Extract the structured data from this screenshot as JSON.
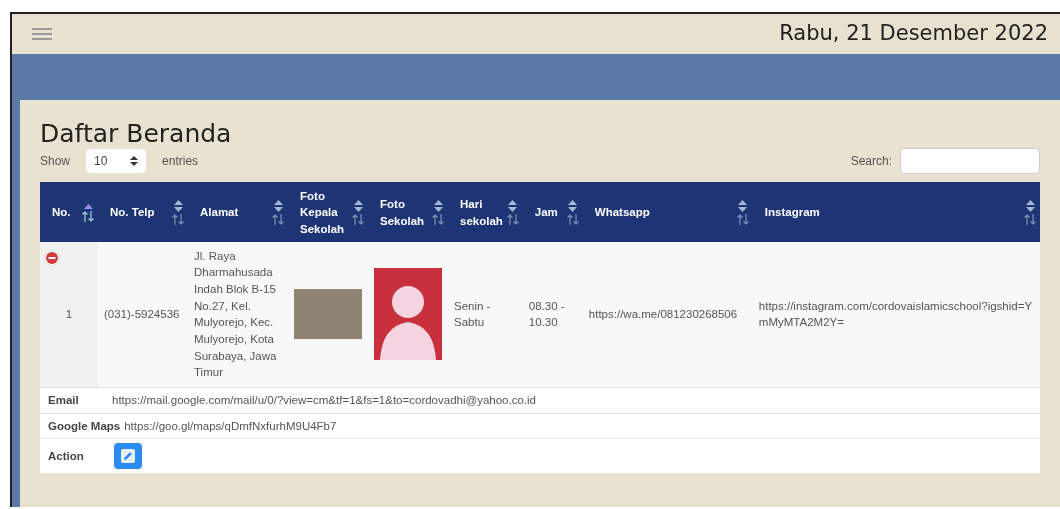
{
  "topbar": {
    "date": "Rabu, 21 Desember 2022"
  },
  "page": {
    "title": "Daftar Beranda",
    "length": {
      "before": "Show",
      "value": "10",
      "after": "entries"
    },
    "search": {
      "label": "Search:"
    }
  },
  "table": {
    "columns": [
      {
        "label": "No.",
        "sorted": true
      },
      {
        "label": "No. Telp",
        "sorted": false
      },
      {
        "label": "Alamat",
        "sorted": false
      },
      {
        "label": "Foto Kepala Sekolah",
        "sorted": false
      },
      {
        "label": "Foto Sekolah",
        "sorted": false
      },
      {
        "label": "Hari sekolah",
        "sorted": false
      },
      {
        "label": "Jam",
        "sorted": false
      },
      {
        "label": "Whatsapp",
        "sorted": false
      },
      {
        "label": "Instagram",
        "sorted": false
      }
    ],
    "rows": [
      {
        "expanded": true,
        "no": "1",
        "telp": "(031)-5924536",
        "alamat": "Jl. Raya Dharmahusada Indah Blok B-15 No.27, Kel. Mulyorejo, Kec. Mulyorejo, Kota Surabaya, Jawa Timur",
        "hari": "Senin - Sabtu",
        "jam": "08.30 - 10.30",
        "whatsapp": "https://wa.me/081230268506",
        "instagram": "https://instagram.com/cordovaislamicschool?igshid=YmMyMTA2M2Y=",
        "details": [
          {
            "kind": "text",
            "label": "Email",
            "value": "https://mail.google.com/mail/u/0/?view=cm&tf=1&fs=1&to=cordovadhi@yahoo.co.id"
          },
          {
            "kind": "text",
            "label": "Google Maps",
            "value": "https://goo.gl/maps/qDmfNxfurhM9U4Fb7"
          },
          {
            "kind": "action",
            "label": "Action"
          }
        ]
      }
    ]
  }
}
